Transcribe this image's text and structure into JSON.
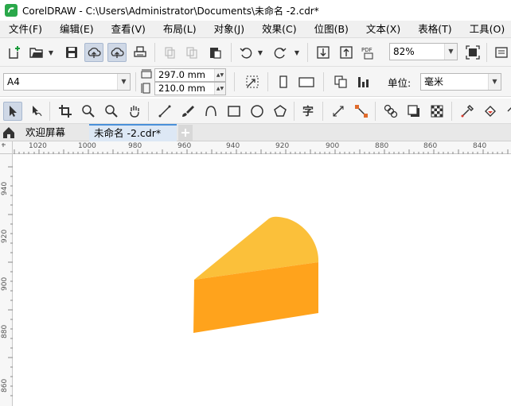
{
  "window": {
    "title": "CorelDRAW - C:\\Users\\Administrator\\Documents\\未命名 -2.cdr*"
  },
  "menu": [
    {
      "label": "文件(F)"
    },
    {
      "label": "编辑(E)"
    },
    {
      "label": "查看(V)"
    },
    {
      "label": "布局(L)"
    },
    {
      "label": "对象(J)"
    },
    {
      "label": "效果(C)"
    },
    {
      "label": "位图(B)"
    },
    {
      "label": "文本(X)"
    },
    {
      "label": "表格(T)"
    },
    {
      "label": "工具(O)"
    }
  ],
  "standard_toolbar": {
    "zoom_value": "82%"
  },
  "property_bar": {
    "page_size": "A4",
    "width_value": "297.0 mm",
    "height_value": "210.0 mm",
    "units_label": "单位:",
    "units_value": "毫米"
  },
  "tabs": [
    {
      "label": "欢迎屏幕"
    },
    {
      "label": "未命名 -2.cdr*"
    }
  ],
  "ruler": {
    "horizontal_labels": [
      "1020",
      "1000",
      "980",
      "960",
      "940",
      "920",
      "900",
      "880",
      "860",
      "840"
    ],
    "vertical_labels": [
      "940",
      "920",
      "900",
      "880",
      "860"
    ]
  },
  "colors": {
    "cheese_top": "#FBC03A",
    "cheese_side": "#FFA31C",
    "accent": "#4a90d9"
  }
}
